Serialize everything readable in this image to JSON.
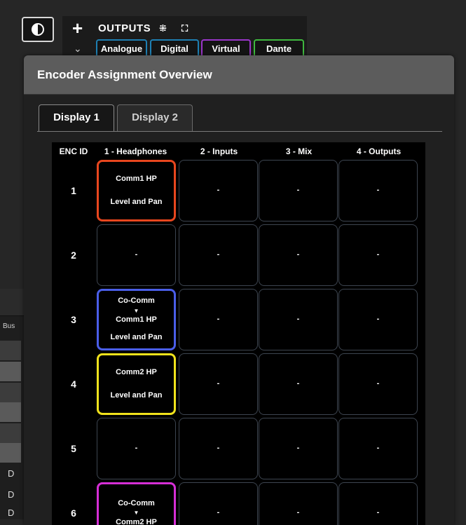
{
  "app": {
    "theme_toggle_icon": "contrast-icon",
    "outputs": {
      "plus_icon": "+",
      "expand_icon": "⌄",
      "label": "OUTPUTS",
      "collapse_glyph": "⁜",
      "fullscreen_glyph": "⛶",
      "tabs": [
        {
          "label": "Analogue",
          "color": "#1e7fb3"
        },
        {
          "label": "Digital",
          "color": "#1e7fb3"
        },
        {
          "label": "Virtual",
          "color": "#9a35c9"
        },
        {
          "label": "Dante",
          "color": "#3fb83f"
        }
      ]
    },
    "left_panel": {
      "bus_label": "Bus",
      "d_labels": [
        "D",
        "D",
        "D"
      ]
    }
  },
  "dialog": {
    "title": "Encoder Assignment Overview",
    "tabs": [
      {
        "label": "Display 1",
        "active": true
      },
      {
        "label": "Display 2",
        "active": false
      }
    ],
    "columns": [
      "ENC ID",
      "1 - Headphones",
      "2 - Inputs",
      "3 - Mix",
      "4 - Outputs"
    ],
    "rows": [
      {
        "id": "1",
        "cells": [
          {
            "lines": [
              "Comm1 HP",
              "Level and Pan"
            ],
            "color": "#e8461e"
          },
          {
            "lines": [
              "-"
            ]
          },
          {
            "lines": [
              "-"
            ]
          },
          {
            "lines": [
              "-"
            ]
          }
        ]
      },
      {
        "id": "2",
        "cells": [
          {
            "lines": [
              "-"
            ]
          },
          {
            "lines": [
              "-"
            ]
          },
          {
            "lines": [
              "-"
            ]
          },
          {
            "lines": [
              "-"
            ]
          }
        ]
      },
      {
        "id": "3",
        "cells": [
          {
            "lines": [
              "Co-Comm",
              "▼",
              "Comm1 HP",
              "Level and Pan"
            ],
            "color": "#4a5ee8"
          },
          {
            "lines": [
              "-"
            ]
          },
          {
            "lines": [
              "-"
            ]
          },
          {
            "lines": [
              "-"
            ]
          }
        ]
      },
      {
        "id": "4",
        "cells": [
          {
            "lines": [
              "Comm2 HP",
              "Level and Pan"
            ],
            "color": "#f0e21c"
          },
          {
            "lines": [
              "-"
            ]
          },
          {
            "lines": [
              "-"
            ]
          },
          {
            "lines": [
              "-"
            ]
          }
        ]
      },
      {
        "id": "5",
        "cells": [
          {
            "lines": [
              "-"
            ]
          },
          {
            "lines": [
              "-"
            ]
          },
          {
            "lines": [
              "-"
            ]
          },
          {
            "lines": [
              "-"
            ]
          }
        ]
      },
      {
        "id": "6",
        "cells": [
          {
            "lines": [
              "Co-Comm",
              "▼",
              "Comm2 HP"
            ],
            "color": "#d62ed6"
          },
          {
            "lines": [
              "-"
            ]
          },
          {
            "lines": [
              "-"
            ]
          },
          {
            "lines": [
              "-"
            ]
          }
        ]
      }
    ]
  }
}
